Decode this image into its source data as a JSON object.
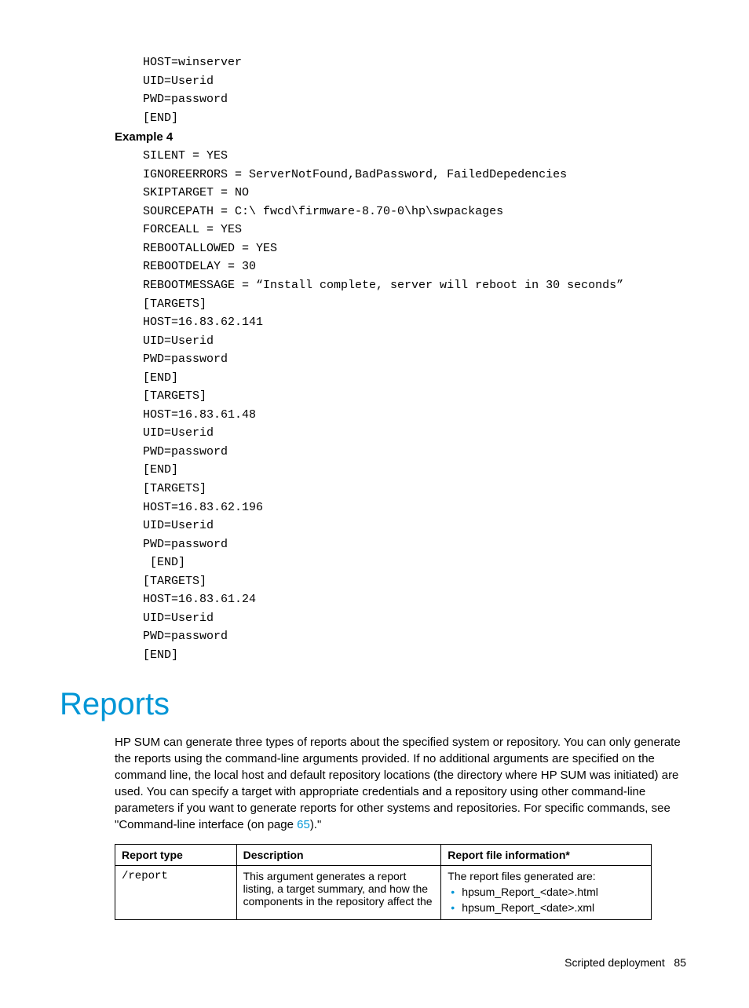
{
  "code_block_1": "HOST=winserver\nUID=Userid\nPWD=password\n[END]",
  "example4_heading": "Example 4",
  "code_block_2": "SILENT = YES\nIGNOREERRORS = ServerNotFound,BadPassword, FailedDepedencies\nSKIPTARGET = NO\nSOURCEPATH = C:\\ fwcd\\firmware-8.70-0\\hp\\swpackages\nFORCEALL = YES\nREBOOTALLOWED = YES\nREBOOTDELAY = 30\nREBOOTMESSAGE = “Install complete, server will reboot in 30 seconds”\n[TARGETS]\nHOST=16.83.62.141\nUID=Userid\nPWD=password\n[END]\n[TARGETS]\nHOST=16.83.61.48\nUID=Userid\nPWD=password\n[END]\n[TARGETS]\nHOST=16.83.62.196\nUID=Userid\nPWD=password\n [END]\n[TARGETS]\nHOST=16.83.61.24\nUID=Userid\nPWD=password\n[END]",
  "section_heading": "Reports",
  "paragraph_pre": "HP SUM can generate three types of reports about the specified system or repository. You can only generate the reports using the command-line arguments provided. If no additional arguments are specified on the command line, the local host and default repository locations (the directory where HP SUM was initiated) are used. You can specify a target with appropriate credentials and a repository using other command-line parameters if you want to generate reports for other systems and repositories. For specific commands, see \"Command-line interface (on page ",
  "paragraph_link": "65",
  "paragraph_post": ").\"",
  "table": {
    "headers": {
      "type": "Report type",
      "desc": "Description",
      "file": "Report file information*"
    },
    "row": {
      "type": "/report",
      "desc": "This argument generates a report listing, a target summary, and how the components in the repository affect the",
      "file_intro": "The report files generated are:",
      "file_item1": "hpsum_Report_<date>.html",
      "file_item2": "hpsum_Report_<date>.xml"
    }
  },
  "footer": {
    "section": "Scripted deployment",
    "page_no": "85"
  }
}
